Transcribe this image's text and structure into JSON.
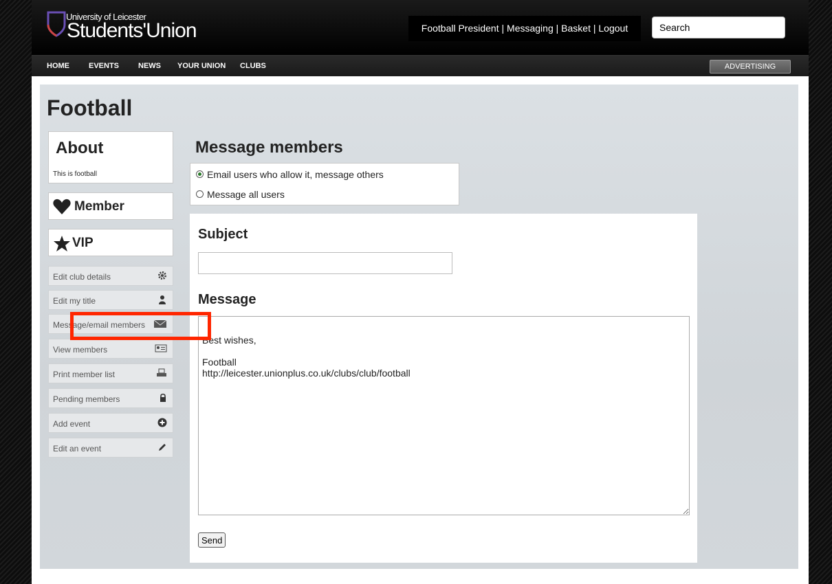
{
  "header": {
    "logo": {
      "line1": "University of Leicester",
      "line2": "Students'Union"
    },
    "user_links": [
      "Football President",
      "Messaging",
      "Basket",
      "Logout"
    ],
    "search": {
      "value": "Search",
      "placeholder": "Search"
    }
  },
  "nav": {
    "items": [
      "HOME",
      "EVENTS",
      "NEWS",
      "YOUR UNION",
      "CLUBS"
    ],
    "advertising": "ADVERTISING"
  },
  "club": {
    "title": "Football",
    "about": {
      "heading": "About",
      "text": "This is football"
    },
    "member_label": "Member",
    "vip_label": "VIP"
  },
  "sidebar": {
    "items": [
      {
        "label": "Edit club details",
        "icon": "gear-icon"
      },
      {
        "label": "Edit my title",
        "icon": "person-icon"
      },
      {
        "label": "Message/email members",
        "icon": "envelope-icon"
      },
      {
        "label": "View members",
        "icon": "id-card-icon"
      },
      {
        "label": "Print member list",
        "icon": "printer-icon"
      },
      {
        "label": "Pending members",
        "icon": "lock-icon"
      },
      {
        "label": "Add event",
        "icon": "plus-circle-icon"
      },
      {
        "label": "Edit an event",
        "icon": "pencil-icon"
      }
    ]
  },
  "message": {
    "title": "Message members",
    "options": [
      {
        "label": "Email users who allow it, message others",
        "selected": true
      },
      {
        "label": "Message all users",
        "selected": false
      }
    ],
    "subject_label": "Subject",
    "subject_value": "",
    "message_label": "Message",
    "message_body": "Best wishes,\n\nFootball\nhttp://leicester.unionplus.co.uk/clubs/club/football",
    "send_label": "Send"
  },
  "colors": {
    "highlight": "#ff2600",
    "header_bg": "#000000",
    "content_bg": "#d6dbdf"
  }
}
